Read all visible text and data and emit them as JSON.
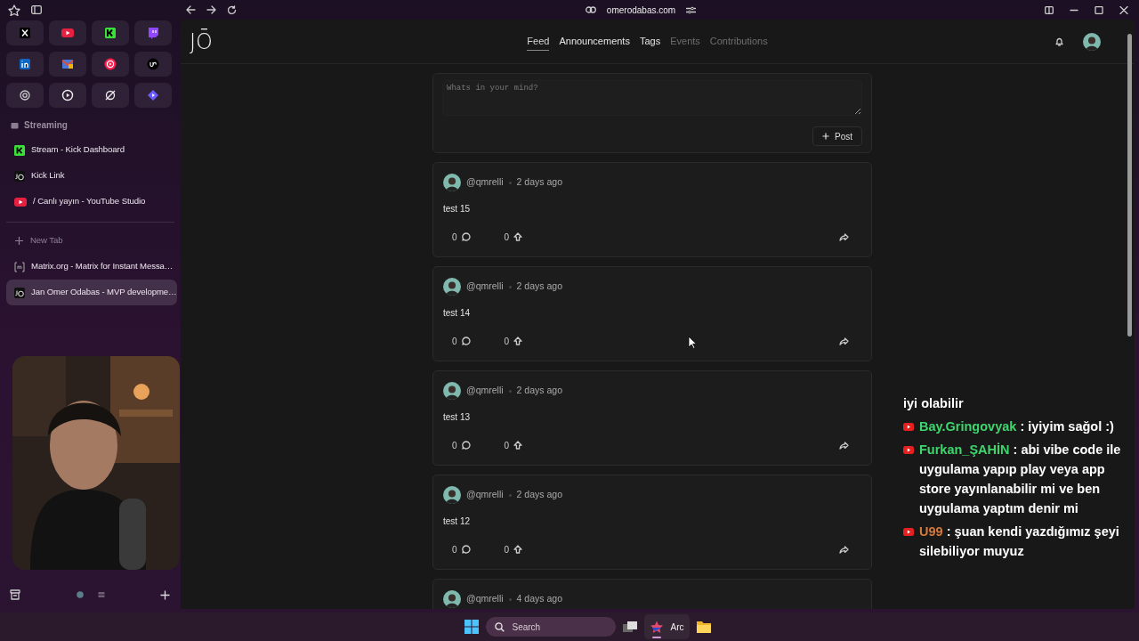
{
  "toolbar": {
    "url": "omerodabas.com"
  },
  "sidebar": {
    "folder": {
      "label": "Streaming",
      "items": [
        {
          "title": "Stream - Kick Dashboard",
          "selected": false
        },
        {
          "title": "Kick Link",
          "selected": false
        },
        {
          "title": "/ Canlı yayın - YouTube Studio",
          "selected": false
        }
      ]
    },
    "new_tab": "New Tab",
    "tabs": [
      {
        "title": "Matrix.org - Matrix for Instant Messa…",
        "selected": false
      },
      {
        "title": "Jan Omer Odabas - MVP developme…",
        "selected": true
      }
    ]
  },
  "site": {
    "logo": "JŌ",
    "nav": [
      {
        "label": "Feed",
        "selected": true,
        "disabled": false
      },
      {
        "label": "Announcements",
        "selected": false,
        "disabled": false
      },
      {
        "label": "Tags",
        "selected": false,
        "disabled": false
      },
      {
        "label": "Events",
        "selected": false,
        "disabled": true
      },
      {
        "label": "Contributions",
        "selected": false,
        "disabled": true
      }
    ]
  },
  "composer": {
    "placeholder": "Whats in your mind?",
    "button": "Post"
  },
  "posts": [
    {
      "user": "@qmrelli",
      "time": "2 days ago",
      "text": "test 15",
      "comments": "0",
      "upvotes": "0"
    },
    {
      "user": "@qmrelli",
      "time": "2 days ago",
      "text": "test 14",
      "comments": "0",
      "upvotes": "0"
    },
    {
      "user": "@qmrelli",
      "time": "2 days ago",
      "text": "test 13",
      "comments": "0",
      "upvotes": "0"
    },
    {
      "user": "@qmrelli",
      "time": "2 days ago",
      "text": "test 12",
      "comments": "0",
      "upvotes": "0"
    },
    {
      "user": "@qmrelli",
      "time": "4 days ago"
    }
  ],
  "chat": {
    "messages": [
      {
        "text": "iyi olabilir"
      },
      {
        "author": "Bay.Gringovyak",
        "color": "#3ed66c",
        "text": ": iyiyim sağol :)"
      },
      {
        "author": "Furkan_ŞAHİN",
        "color": "#3ed66c",
        "text": ": abi vibe code ile uygulama yapıp play veya app store yayınlanabilir mi ve ben uygulama yaptım denir mi"
      },
      {
        "author": "U99",
        "color": "#d47a3a",
        "text": ": şuan kendi yazdığımız şeyi silebiliyor muyuz"
      }
    ]
  },
  "taskbar": {
    "search": {
      "placeholder": "Search"
    },
    "app": {
      "label": "Arc",
      "active": true
    }
  }
}
